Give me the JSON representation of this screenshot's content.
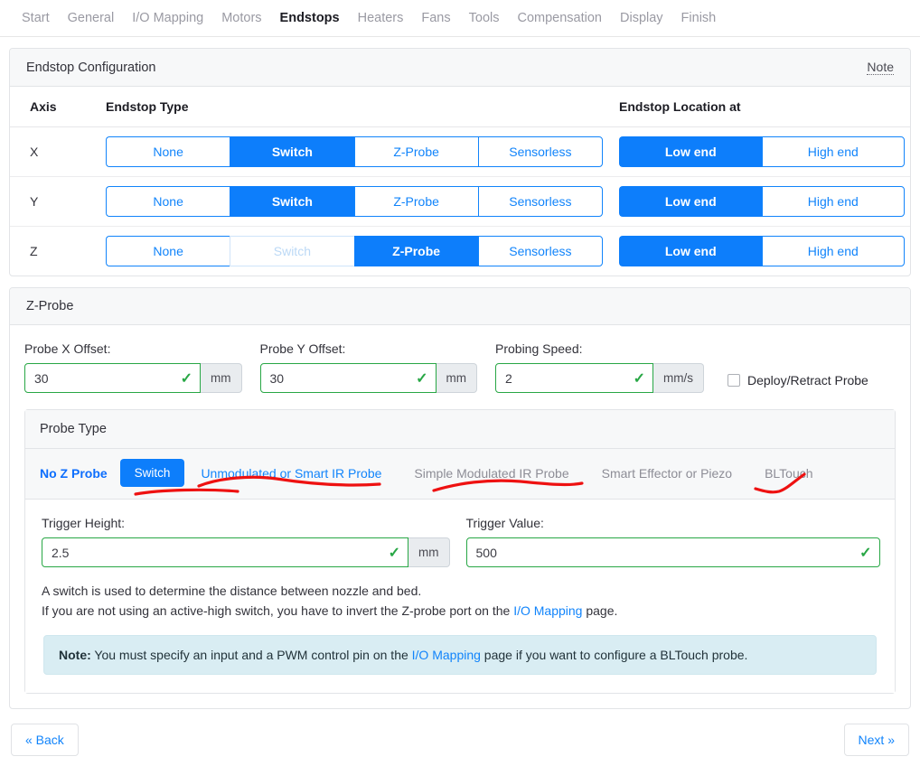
{
  "nav": {
    "items": [
      {
        "label": "Start",
        "active": false
      },
      {
        "label": "General",
        "active": false
      },
      {
        "label": "I/O Mapping",
        "active": false
      },
      {
        "label": "Motors",
        "active": false
      },
      {
        "label": "Endstops",
        "active": true
      },
      {
        "label": "Heaters",
        "active": false
      },
      {
        "label": "Fans",
        "active": false
      },
      {
        "label": "Tools",
        "active": false
      },
      {
        "label": "Compensation",
        "active": false
      },
      {
        "label": "Display",
        "active": false
      },
      {
        "label": "Finish",
        "active": false
      }
    ]
  },
  "endstop_card": {
    "title": "Endstop Configuration",
    "note_link": "Note",
    "columns": {
      "axis": "Axis",
      "type": "Endstop Type",
      "location": "Endstop Location at"
    },
    "type_options": [
      "None",
      "Switch",
      "Z-Probe",
      "Sensorless"
    ],
    "location_options": [
      "Low end",
      "High end"
    ],
    "rows": [
      {
        "axis": "X",
        "type_selected": "Switch",
        "type_disabled": "",
        "location_selected": "Low end"
      },
      {
        "axis": "Y",
        "type_selected": "Switch",
        "type_disabled": "",
        "location_selected": "Low end"
      },
      {
        "axis": "Z",
        "type_selected": "Z-Probe",
        "type_disabled": "Switch",
        "location_selected": "Low end"
      }
    ]
  },
  "zprobe_card": {
    "title": "Z-Probe",
    "fields": {
      "probe_x_offset": {
        "label": "Probe X Offset:",
        "value": "30",
        "unit": "mm",
        "valid": true
      },
      "probe_y_offset": {
        "label": "Probe Y Offset:",
        "value": "30",
        "unit": "mm",
        "valid": true
      },
      "probing_speed": {
        "label": "Probing Speed:",
        "value": "2",
        "unit": "mm/s",
        "valid": true
      }
    },
    "deploy_retract": {
      "label": "Deploy/Retract Probe",
      "checked": false
    },
    "probe_type": {
      "title": "Probe Type",
      "no_z_probe": "No Z Probe",
      "tabs": [
        {
          "label": "Switch",
          "state": "active"
        },
        {
          "label": "Unmodulated or Smart IR Probe",
          "state": "link"
        },
        {
          "label": "Simple Modulated IR Probe",
          "state": "muted"
        },
        {
          "label": "Smart Effector or Piezo",
          "state": "muted"
        },
        {
          "label": "BLTouch",
          "state": "muted"
        }
      ]
    },
    "trigger_height": {
      "label": "Trigger Height:",
      "value": "2.5",
      "unit": "mm",
      "valid": true
    },
    "trigger_value": {
      "label": "Trigger Value:",
      "value": "500",
      "unit": "",
      "valid": true
    },
    "help_line_1": "A switch is used to determine the distance between nozzle and bed.",
    "help_line_2_pre": "If you are not using an active-high switch, you have to invert the Z-probe port on the ",
    "help_line_2_link": "I/O Mapping",
    "help_line_2_post": " page.",
    "note": {
      "prefix": "Note:",
      "text_pre": " You must specify an input and a PWM control pin on the ",
      "link": "I/O Mapping",
      "text_post": " page if you want to configure a BLTouch probe."
    }
  },
  "footer": {
    "back_label": "« Back",
    "next_label": "Next »"
  },
  "colors": {
    "accent": "#0d7efb",
    "link": "#1184fb",
    "valid": "#28a745",
    "note_bg": "#d9edf3",
    "annotation": "#ee1111"
  }
}
